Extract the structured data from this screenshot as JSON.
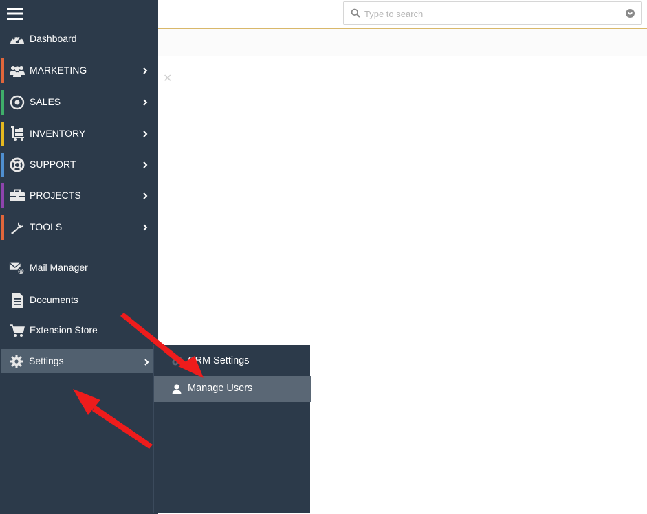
{
  "search": {
    "placeholder": "Type to search"
  },
  "sidebar": {
    "items": [
      {
        "label": "Dashboard",
        "icon": "dashboard-icon",
        "accent": ""
      },
      {
        "label": "MARKETING",
        "icon": "users-group-icon",
        "accent": "#e0663b"
      },
      {
        "label": "SALES",
        "icon": "target-icon",
        "accent": "#3fae6a"
      },
      {
        "label": "INVENTORY",
        "icon": "cart-dolly-icon",
        "accent": "#e5b820"
      },
      {
        "label": "SUPPORT",
        "icon": "lifebuoy-icon",
        "accent": "#4f8fd0"
      },
      {
        "label": "PROJECTS",
        "icon": "briefcase-icon",
        "accent": "#8e44ad"
      },
      {
        "label": "TOOLS",
        "icon": "wrench-icon",
        "accent": "#e0663b"
      }
    ],
    "utility": [
      {
        "label": "Mail Manager",
        "icon": "mail-at-icon"
      },
      {
        "label": "Documents",
        "icon": "document-icon"
      },
      {
        "label": "Extension Store",
        "icon": "cart-icon"
      }
    ],
    "settings": {
      "label": "Settings",
      "icon": "gear-icon"
    }
  },
  "submenu": {
    "items": [
      {
        "label": "CRM Settings",
        "icon": "gears-icon"
      },
      {
        "label": "Manage Users",
        "icon": "user-icon"
      }
    ]
  },
  "colors": {
    "sidebar_bg": "#2c3a4a",
    "highlight": "#51606f",
    "arrow": "#ee1c1c"
  }
}
